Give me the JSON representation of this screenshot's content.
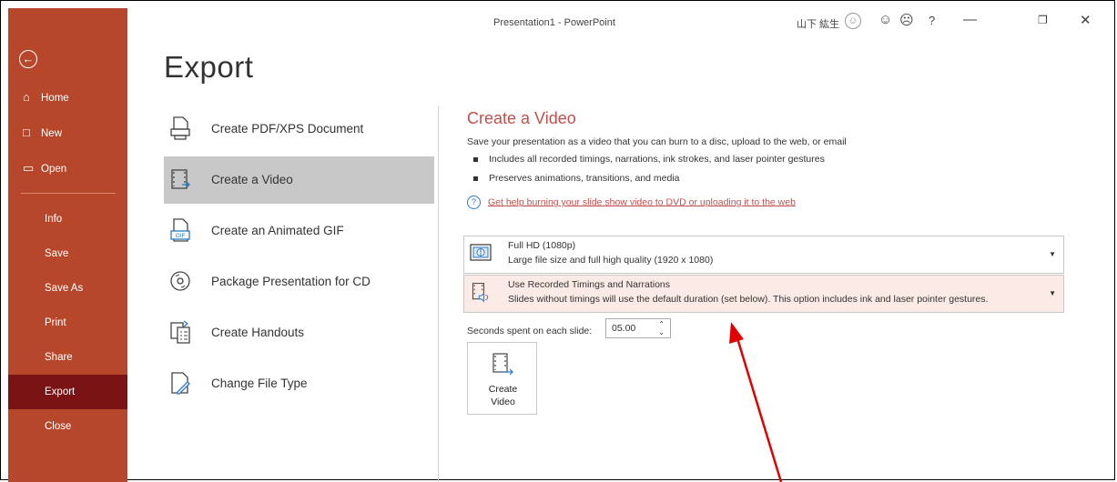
{
  "window": {
    "title": "Presentation1  -  PowerPoint",
    "user": "山下 紘生",
    "controls": [
      "smile-icon",
      "frown-icon",
      "help-icon",
      "minimize-icon",
      "restore-icon",
      "close-icon"
    ],
    "help_glyph": "?"
  },
  "sidebar": {
    "back_icon": "back-arrow-icon",
    "items": [
      {
        "label": "Home",
        "icon": "home-icon"
      },
      {
        "label": "New",
        "icon": "new-document-icon"
      },
      {
        "label": "Open",
        "icon": "open-folder-icon"
      },
      {
        "label": "Info"
      },
      {
        "label": "Save"
      },
      {
        "label": "Save As"
      },
      {
        "label": "Print"
      },
      {
        "label": "Share"
      },
      {
        "label": "Export",
        "selected": true
      },
      {
        "label": "Close"
      }
    ],
    "color": "#b7472a",
    "selected_color": "#7a1414"
  },
  "page_title": "Export",
  "export_options": [
    {
      "label": "Create PDF/XPS Document",
      "icon": "pdf-document-icon"
    },
    {
      "label": "Create a Video",
      "icon": "video-icon",
      "selected": true
    },
    {
      "label": "Create an Animated GIF",
      "icon": "gif-icon"
    },
    {
      "label": "Package Presentation for CD",
      "icon": "cd-icon"
    },
    {
      "label": "Create Handouts",
      "icon": "handouts-icon"
    },
    {
      "label": "Change File Type",
      "icon": "change-file-type-icon"
    }
  ],
  "panel": {
    "title": "Create a Video",
    "description": "Save your presentation as a video that you can burn to a disc, upload to the web, or email",
    "bullets": [
      "Includes all recorded timings, narrations, ink strokes, and laser pointer gestures",
      "Preserves animations, transitions, and media"
    ],
    "help_link": "Get help burning your slide show video to DVD or uploading it to the web",
    "quality_dropdown": {
      "line1": "Full HD (1080p)",
      "line2": "Large file size and full high quality (1920 x 1080)",
      "icon": "monitor-icon"
    },
    "timing_dropdown": {
      "line1": "Use Recorded Timings and Narrations",
      "line2": "Slides without timings will use the default duration (set below). This option includes ink and laser pointer gestures.",
      "icon": "narration-icon"
    },
    "seconds_label": "Seconds spent on each slide:",
    "seconds_value": "05.00",
    "create_button": {
      "line1": "Create",
      "line2": "Video"
    }
  },
  "annotation": {
    "color": "#e00000"
  },
  "accent_color": "#c0504d"
}
